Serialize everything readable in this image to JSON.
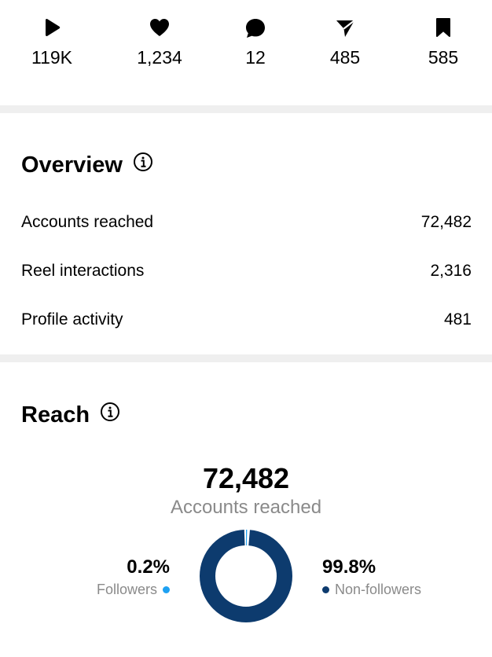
{
  "stats": [
    {
      "icon": "play-icon",
      "value": "119K"
    },
    {
      "icon": "heart-icon",
      "value": "1,234"
    },
    {
      "icon": "comment-icon",
      "value": "12"
    },
    {
      "icon": "send-icon",
      "value": "485"
    },
    {
      "icon": "bookmark-icon",
      "value": "585"
    }
  ],
  "overview": {
    "title": "Overview",
    "rows": [
      {
        "label": "Accounts reached",
        "value": "72,482"
      },
      {
        "label": "Reel interactions",
        "value": "2,316"
      },
      {
        "label": "Profile activity",
        "value": "481"
      }
    ]
  },
  "reach": {
    "title": "Reach",
    "total": "72,482",
    "subtitle": "Accounts reached",
    "followers": {
      "pct": "0.2%",
      "label": "Followers",
      "color": "#1ea1f2",
      "fraction": 0.002
    },
    "non_followers": {
      "pct": "99.8%",
      "label": "Non-followers",
      "color": "#0d3b6e",
      "fraction": 0.998
    }
  }
}
